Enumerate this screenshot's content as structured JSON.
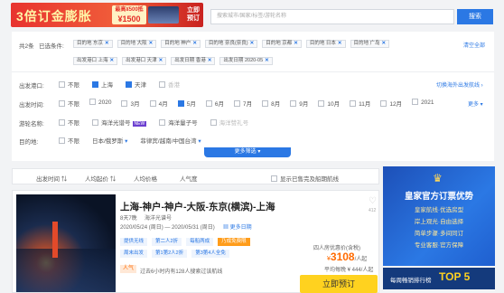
{
  "banner": {
    "big_text": "3倍订金膨胀",
    "amount_line1": "最高¥500抵",
    "amount_line2": "¥1500",
    "cta": "立即预订"
  },
  "search": {
    "placeholder": "搜索城市/国家/标签/游轮名称",
    "button": "搜索"
  },
  "selected": {
    "count_label": "共2条",
    "label": "已选条件:",
    "tags_row1": [
      "目的地 东京",
      "目的地 大阪",
      "目的地 神户",
      "目的地 奈良(奈良)",
      "目的地 京都",
      "目的地 日本",
      "目的地 广岛"
    ],
    "tags_row2": [
      "出发港口 上海",
      "出发港口 天津",
      "出发日期 香港",
      "出发日期 2020-05"
    ],
    "clear_all": "清空全部"
  },
  "filters": {
    "port": {
      "label": "出发港口:",
      "options": [
        "不限",
        "上海",
        "天津",
        "香港"
      ],
      "checked": [
        false,
        true,
        true,
        false
      ],
      "disabled": [
        false,
        false,
        false,
        true
      ],
      "switch_link": "切换海外出发航线 ›"
    },
    "time": {
      "label": "出发时间:",
      "options": [
        "不限",
        "2020",
        "3月",
        "4月",
        "5月",
        "6月",
        "7月",
        "8月",
        "9月",
        "10月",
        "11月",
        "12月",
        "2021"
      ],
      "checked": [
        false,
        false,
        false,
        false,
        true,
        false,
        false,
        false,
        false,
        false,
        false,
        false,
        false
      ],
      "more": "更多 ▾"
    },
    "ship": {
      "label": "游轮名称:",
      "options": [
        "不限",
        "海洋光谱号",
        "海洋量子号",
        "海洋赞礼号"
      ],
      "new_badge": "NEW"
    },
    "dest": {
      "label": "目的地:",
      "options": [
        "不限",
        "日本/俄罗斯",
        "菲律宾/越南/中国台湾"
      ]
    },
    "more_button": "更多筛选 ▾"
  },
  "sort": {
    "items": [
      "出发时间 ⇅",
      "人均起价 ⇅",
      "人均价格",
      "人气度"
    ],
    "checkbox": "显示已售完及船期航线"
  },
  "product": {
    "title": "上海-神户-神户-大阪-东京(横滨)-上海",
    "duration": "8天7晚",
    "ship": "海洋光谱号",
    "dates": "2020/05/24 (周日) — 2020/05/31 (周日)",
    "more_dates": "更多日期",
    "tags_row1": [
      "提供无线",
      "第二人2折",
      "每船两成",
      "乃成免费限"
    ],
    "tags_row2": [
      "周末出发",
      "第1第2人2折",
      "第3第4人全免"
    ],
    "fav_count": "412",
    "price_label": "四人房优惠价(含税)",
    "price": "3108",
    "price_prefix": "¥",
    "price_suffix": "/人起",
    "avg_line": "平均每晚 ¥ 444/人起",
    "hot_badge": "人气",
    "booked": "过去6小时内有128人搜索过该航线",
    "buy_button": "立即预订"
  },
  "ad": {
    "title": "皇家官方订票优势",
    "lines": [
      "皇家航线·优选房型",
      "岸上观光·自由选择",
      "简单步骤·多间同订",
      "专业客服·官方保障"
    ],
    "rank_label": "每周畅销排行榜",
    "rank_badge": "TOP 5"
  }
}
